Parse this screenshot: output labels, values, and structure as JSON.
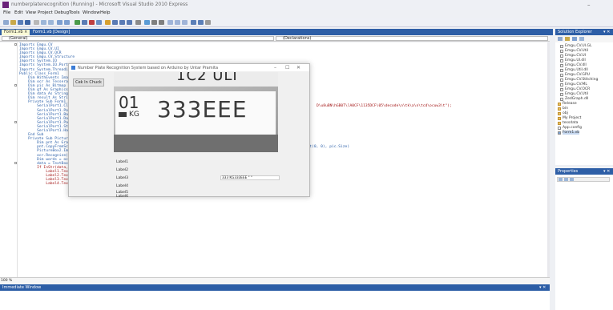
{
  "window": {
    "title": "numberplaterecognition (Running) - Microsoft Visual Studio 2010 Express",
    "min_glyph": "–"
  },
  "menu": [
    "File",
    "Edit",
    "View",
    "Project",
    "Debug",
    "Tools",
    "Window",
    "Help"
  ],
  "tabs": [
    {
      "label": "Form1.vb ×",
      "active": true
    },
    {
      "label": "Form1.vb [Design]",
      "active": false
    }
  ],
  "navbar": {
    "left": "(General)",
    "right": "(Declarations)"
  },
  "code_lines": [
    "Imports Emgu.CV",
    "Imports Emgu.CV.UI",
    "Imports Emgu.CV.OCR",
    "Imports Emgu.CV.Structure",
    "",
    "Imports System.IO",
    "Imports System.IO.Ports",
    "Imports System.Threading",
    "",
    "",
    "Public Class Form1",
    "    Dim WithEvents ImageBox As Emgu.CV.UI.ImageBox",
    "    Dim ocr As Tesseract",
    "    Dim pic As Bitmap",
    "    Dim gf As Graphics",
    "    Dim data As String",
    "    Dim result As String",
    "",
    "",
    "    Private Sub Form1_Load(...)",
    "        SerialPort1.Close()",
    "        SerialPort1.PortName = \"COM3\"",
    "        SerialPort1.BaudRate = 9600",
    "        SerialPort1.DataBits = 8",
    "        SerialPort1.Parity = Parity.None",
    "        SerialPort1.StopBits = StopBits.One",
    "        SerialPort1.Handshake = Handshake.None",
    "    End Sub",
    "",
    "    Private Sub PictureBox1_MouseUp(ByVal sender As Object, ByVal e As MouseEventArgs) Handles PictureBox1.MouseUp",
    "        Dim pnt As Graphics = Graphics.FromImage(pic)",
    "        pnt.CopyFromScreen(New Point(Me.Location.X + PictureBox1.Location.X, Me.Location.Y + PictureBox1.Location.Y + 30), New Point(0, 0), pic.Size)",
    "        PictureBox2.Image = pic",
    "        ocr.Recognize(New Image(Of Bgr, Byte)(pic))",
    "        Dim words = ocr.GetText",
    "        data = TextBox1.Text",
    "        If InStr(data, \"333EEE\") Or InStr(data, \"333EEE\") Then",
    "            Label1.Text = \"Registered\"",
    "            Label2.Text = \"Owner\"",
    "            Label3.Text = \"Vehicle\"",
    "            Label4.Text = \"Year\""
  ],
  "long_string_fragment": "D\\u8uBN\\hGB0T\\lA0CF\\1135DCF\\05\\decode\\n\\tk\\a\\n\\tcd\\ocuw3\\t\");",
  "zoom": "100 %",
  "immediate_window": {
    "title": "Immediate Window",
    "controls": "▾ ✕"
  },
  "solution_explorer": {
    "title": "Solution Explorer",
    "controls": "▾ ✕",
    "items": [
      "Emgu.CV.UI.GL",
      "Emgu.CV.Util",
      "Emgu.CV.UI",
      "Emgu.UI.dll",
      "Emgu.CV.dll",
      "Emgu.Util.dll",
      "Emgu.CV.GPU",
      "Emgu.CV.Stitching",
      "Emgu.CV.ML",
      "Emgu.CV.OCR",
      "Emgu.CV.Util",
      "ZedGraph.dll",
      "Release",
      "bin",
      "obj",
      "My Project",
      "tessdata",
      "App.config",
      "Form1.vb"
    ]
  },
  "properties": {
    "title": "Properties",
    "controls": "▾ ✕"
  },
  "form": {
    "title": "Number Plate Recognition System based on Arduino by Untar Pramita",
    "min_glyph": "–",
    "max_glyph": "☐",
    "close_glyph": "✕",
    "button_label": "Cek In Chuck",
    "plate_top_text": "1C2 ULI",
    "plate_region": "01",
    "plate_country": "KG",
    "plate_number": "333EEE",
    "labels": [
      "Label1",
      "Label2",
      "Label3",
      "Label4",
      "Label5",
      "Label6"
    ],
    "result_text": "333 KG333EEE \" °"
  },
  "colors": {
    "vs_blue": "#2d5ea6",
    "keyword": "#2b5fa8",
    "string": "#a31515"
  }
}
